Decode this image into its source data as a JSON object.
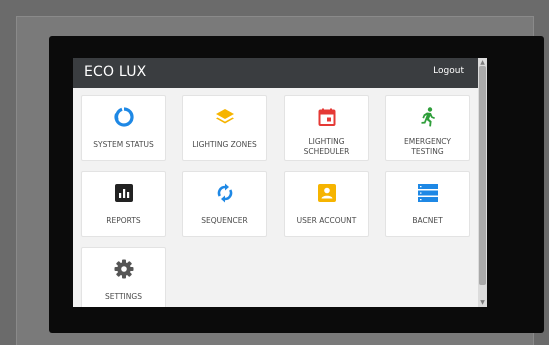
{
  "app": {
    "title": "ECO LUX",
    "logout_label": "Logout"
  },
  "tiles": [
    {
      "label": "SYSTEM STATUS",
      "icon": "refresh-ring-icon",
      "color": "#1e88e5"
    },
    {
      "label": "LIGHTING ZONES",
      "icon": "layers-icon",
      "color": "#f6b400"
    },
    {
      "label": "LIGHTING SCHEDULER",
      "icon": "calendar-icon",
      "color": "#e53935"
    },
    {
      "label": "EMERGENCY TESTING",
      "icon": "running-man-icon",
      "color": "#2e9e3a"
    },
    {
      "label": "REPORTS",
      "icon": "bar-chart-icon",
      "color": "#222222"
    },
    {
      "label": "SEQUENCER",
      "icon": "sync-icon",
      "color": "#1e88e5"
    },
    {
      "label": "USER ACCOUNT",
      "icon": "user-card-icon",
      "color": "#f6b400"
    },
    {
      "label": "BACNET",
      "icon": "server-icon",
      "color": "#1e88e5"
    },
    {
      "label": "SETTINGS",
      "icon": "gear-icon",
      "color": "#555555"
    }
  ]
}
